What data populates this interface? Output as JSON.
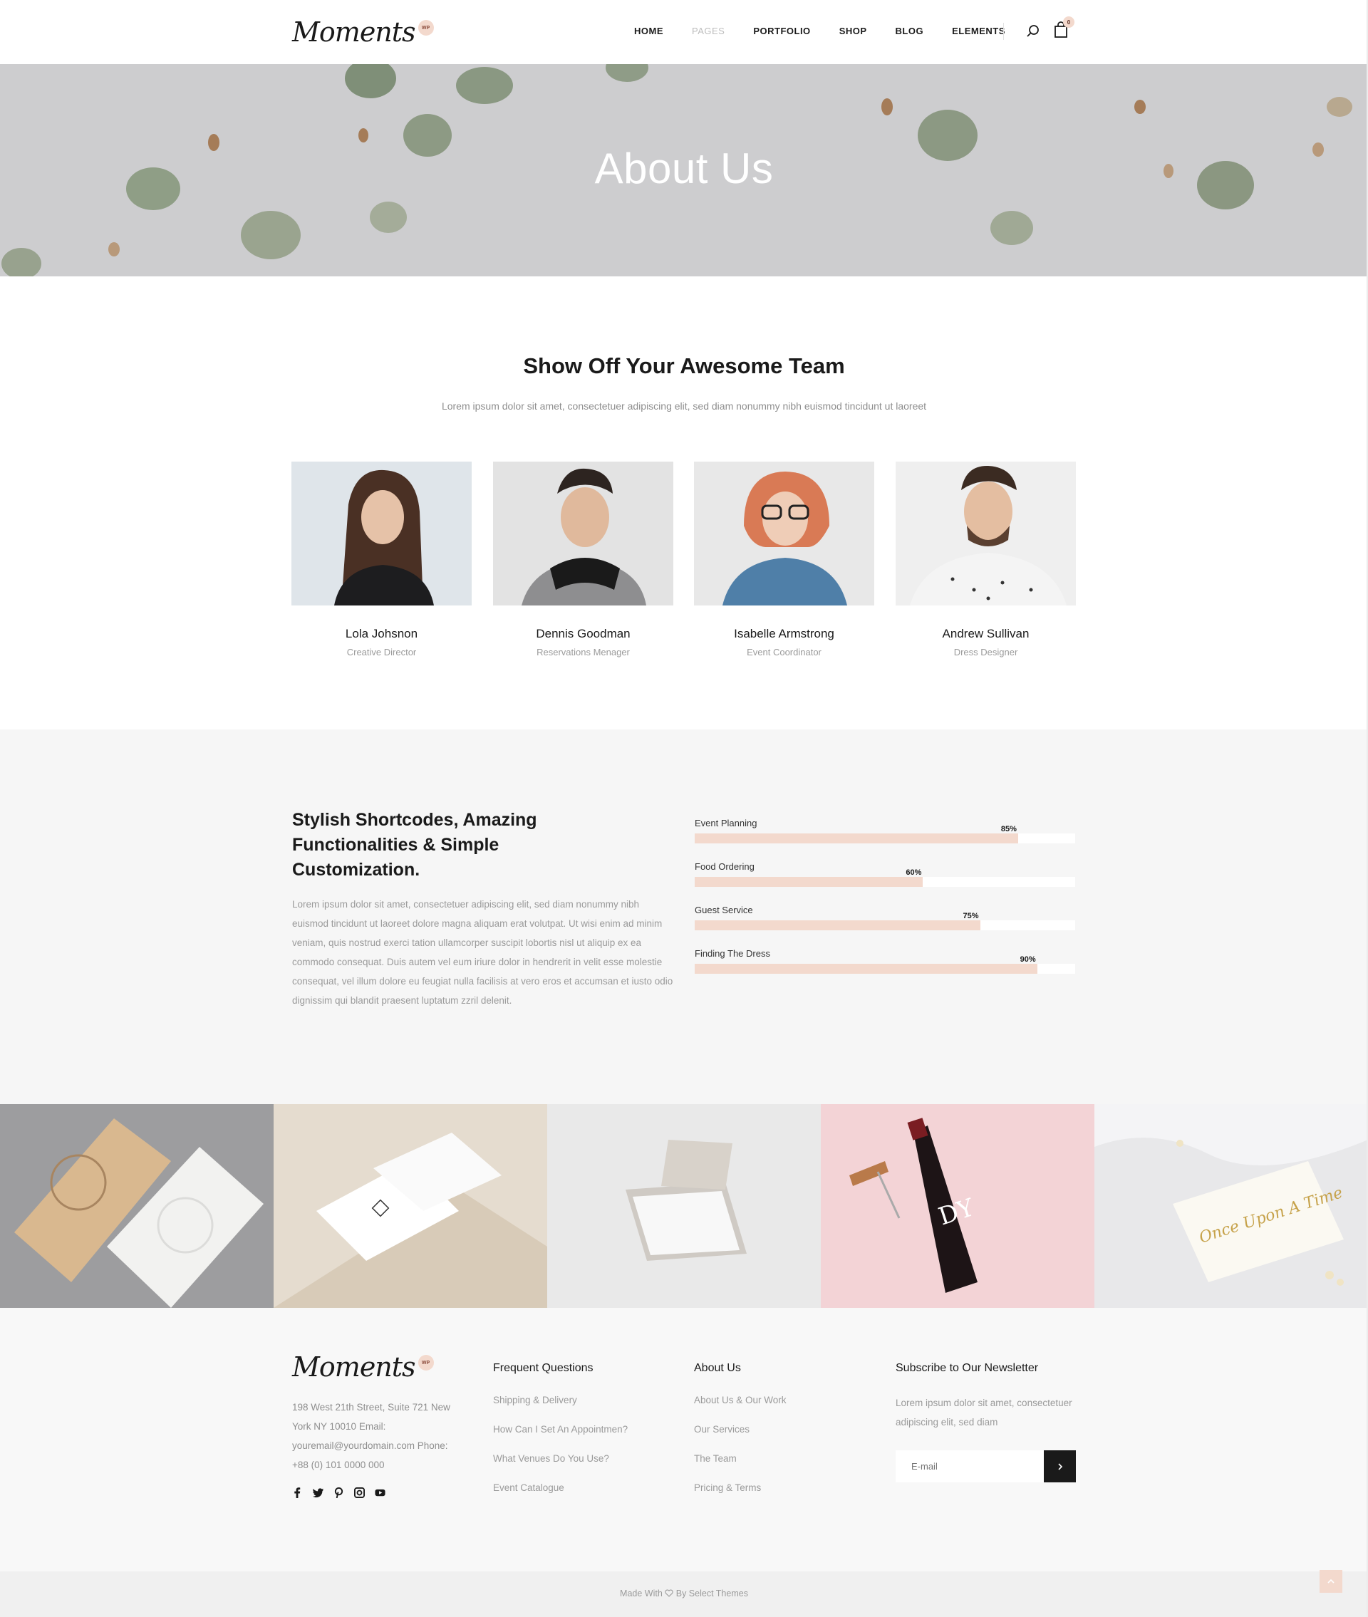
{
  "header": {
    "logo_text": "Moments",
    "logo_badge": "WP",
    "nav": [
      "HOME",
      "PAGES",
      "PORTFOLIO",
      "SHOP",
      "BLOG",
      "ELEMENTS"
    ],
    "cart_count": "0"
  },
  "hero": {
    "title": "About Us"
  },
  "team": {
    "title": "Show Off Your Awesome Team",
    "subtitle": "Lorem ipsum dolor sit amet, consectetuer adipiscing elit, sed diam nonummy nibh euismod tincidunt ut laoreet",
    "members": [
      {
        "name": "Lola Johsnon",
        "role": "Creative Director"
      },
      {
        "name": "Dennis Goodman",
        "role": "Reservations Menager"
      },
      {
        "name": "Isabelle Armstrong",
        "role": "Event Coordinator"
      },
      {
        "name": "Andrew Sullivan",
        "role": "Dress Designer"
      }
    ]
  },
  "skills": {
    "title": "Stylish Shortcodes, Amazing Functionalities & Simple Customization.",
    "text": "Lorem ipsum dolor sit amet, consectetuer adipiscing elit, sed diam nonummy nibh euismod tincidunt ut laoreet dolore magna aliquam erat volutpat. Ut wisi enim ad minim veniam, quis nostrud exerci tation ullamcorper suscipit lobortis nisl ut aliquip ex ea commodo consequat. Duis autem vel eum iriure dolor in hendrerit in velit esse molestie consequat, vel illum dolore eu feugiat nulla facilisis at vero eros et accumsan et iusto odio dignissim qui blandit praesent luptatum zzril delenit.",
    "bars": [
      {
        "label": "Event Planning",
        "percent": 85,
        "percent_label": "85%"
      },
      {
        "label": "Food Ordering",
        "percent": 60,
        "percent_label": "60%"
      },
      {
        "label": "Guest Service",
        "percent": 75,
        "percent_label": "75%"
      },
      {
        "label": "Finding The Dress",
        "percent": 90,
        "percent_label": "90%"
      }
    ]
  },
  "footer": {
    "logo_text": "Moments",
    "logo_badge": "WP",
    "address": "198 West 21th Street, Suite 721 New York NY 10010 Email: youremail@yourdomain.com Phone: +88 (0) 101 0000 000",
    "col1": {
      "title": "Frequent Questions",
      "links": [
        "Shipping & Delivery",
        "How Can I Set An Appointmen?",
        "What Venues Do You Use?",
        "Event Catalogue"
      ]
    },
    "col2": {
      "title": "About Us",
      "links": [
        "About Us & Our Work",
        "Our Services",
        "The Team",
        "Pricing & Terms"
      ]
    },
    "newsletter": {
      "title": "Subscribe to Our Newsletter",
      "text": "Lorem ipsum dolor sit amet, consectetuer adipiscing elit, sed diam",
      "placeholder": "E-mail"
    },
    "credits_prefix": "Made With",
    "credits_suffix": "By Select Themes"
  },
  "colors": {
    "accent": "#f3d9cd",
    "dark": "#1a1a1a",
    "muted": "#9a9a9a"
  }
}
